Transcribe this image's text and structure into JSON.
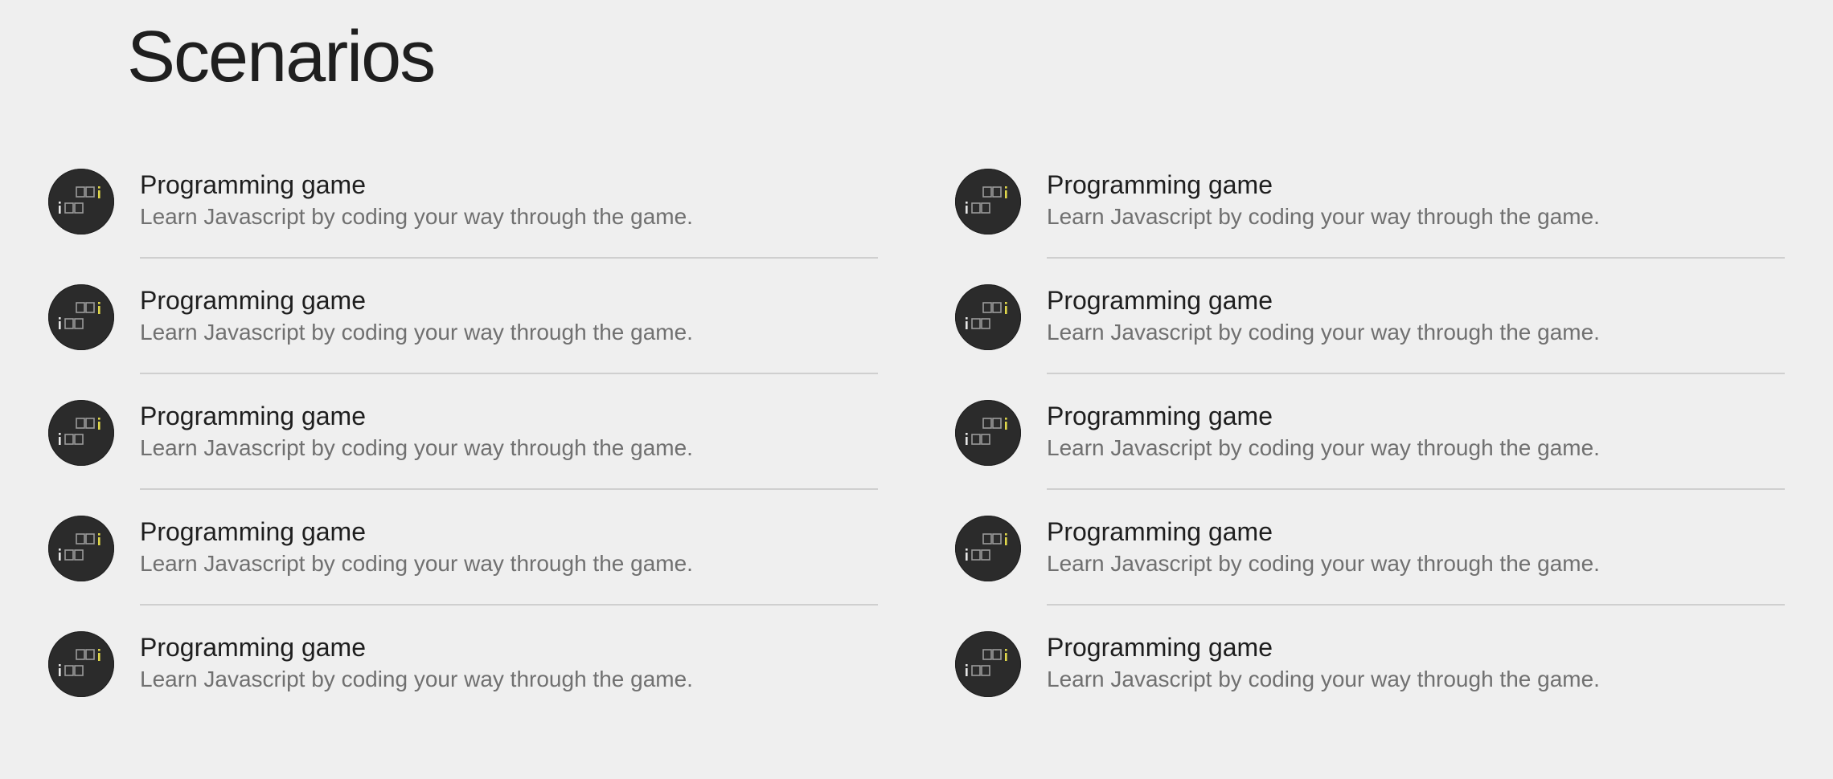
{
  "page": {
    "title": "Scenarios"
  },
  "icon": {
    "name": "programming-game-icon",
    "background": "#2b2b2b",
    "tile_color": "#9a9a9a",
    "accent_color": "#e0d84a"
  },
  "columns": [
    {
      "items": [
        {
          "title": "Programming game",
          "description": "Learn Javascript by coding your way through the game."
        },
        {
          "title": "Programming game",
          "description": "Learn Javascript by coding your way through the game."
        },
        {
          "title": "Programming game",
          "description": "Learn Javascript by coding your way through the game."
        },
        {
          "title": "Programming game",
          "description": "Learn Javascript by coding your way through the game."
        },
        {
          "title": "Programming game",
          "description": "Learn Javascript by coding your way through the game."
        }
      ]
    },
    {
      "items": [
        {
          "title": "Programming game",
          "description": "Learn Javascript by coding your way through the game."
        },
        {
          "title": "Programming game",
          "description": "Learn Javascript by coding your way through the game."
        },
        {
          "title": "Programming game",
          "description": "Learn Javascript by coding your way through the game."
        },
        {
          "title": "Programming game",
          "description": "Learn Javascript by coding your way through the game."
        },
        {
          "title": "Programming game",
          "description": "Learn Javascript by coding your way through the game."
        }
      ]
    }
  ]
}
